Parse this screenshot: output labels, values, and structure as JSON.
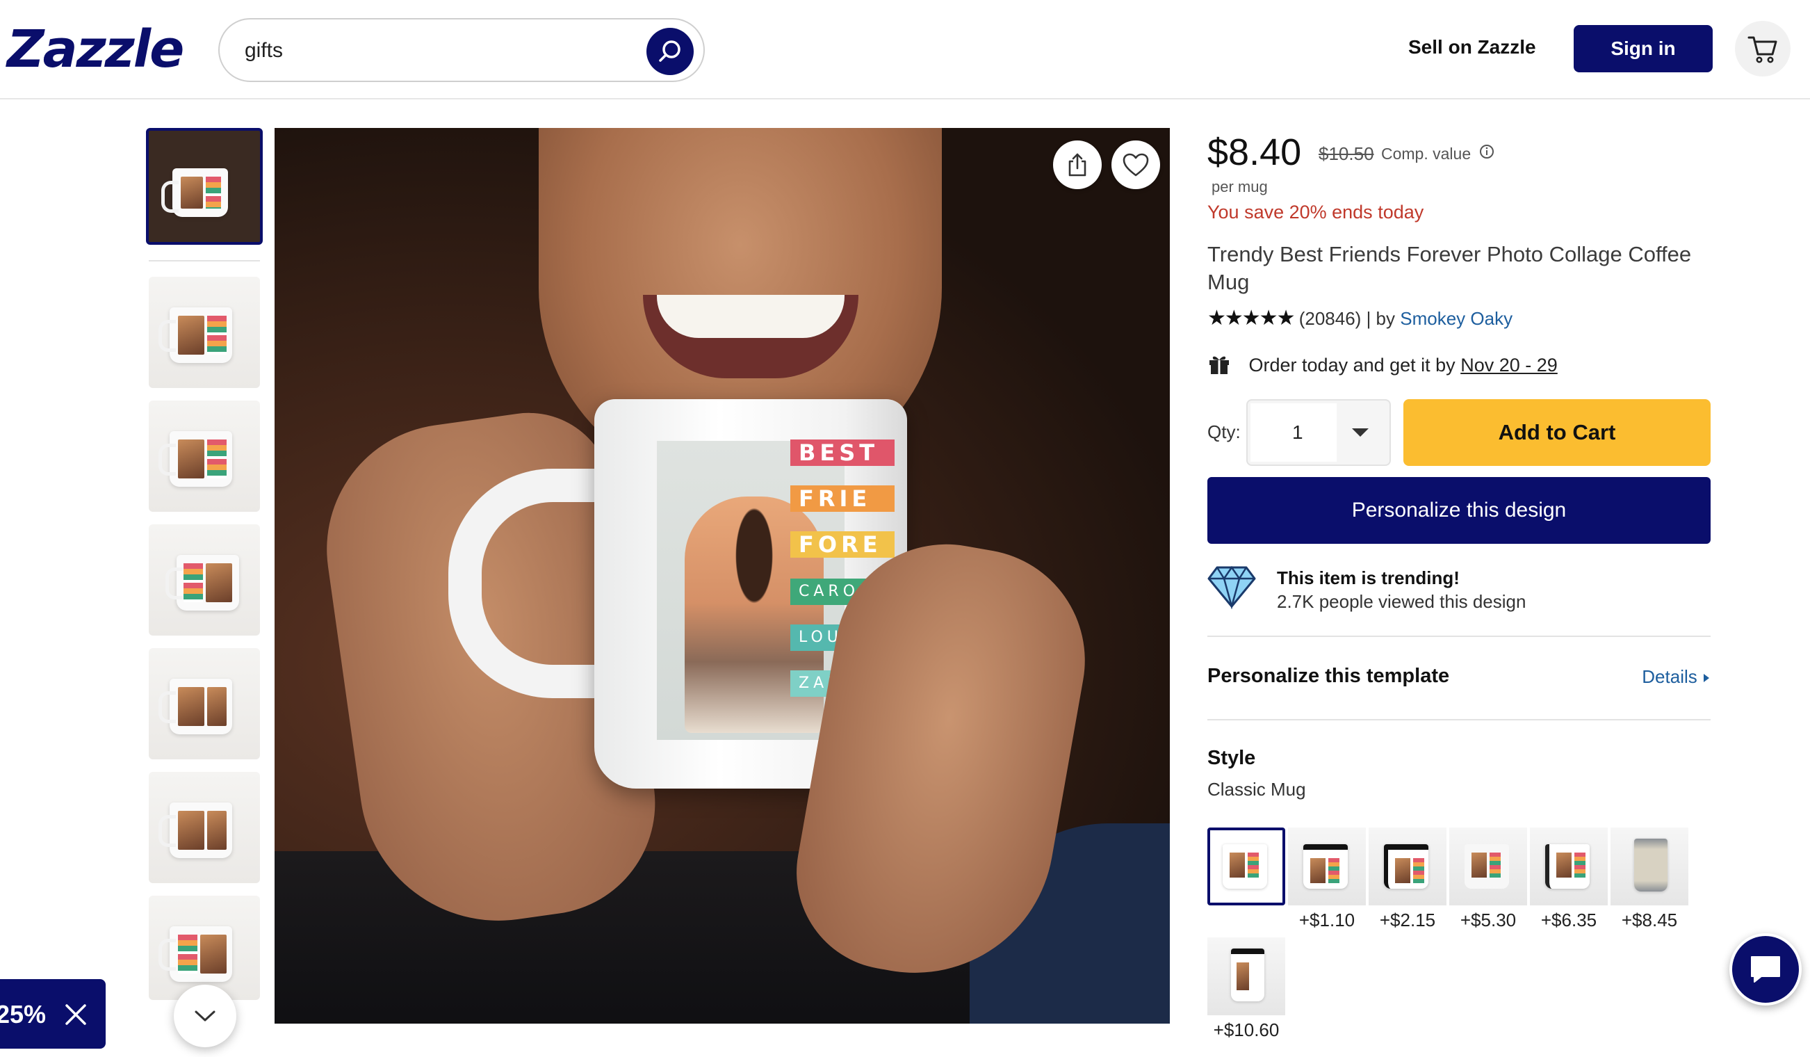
{
  "header": {
    "logo": "Zazzle",
    "search_value": "gifts",
    "sell_label": "Sell on Zazzle",
    "signin_label": "Sign in"
  },
  "gallery": {
    "mug_stripes": [
      "BEST",
      "FRIE",
      "FORE",
      "CAROLIN",
      "LOUISA",
      "ZARA"
    ]
  },
  "promo": {
    "text": "25%"
  },
  "product": {
    "price": "$8.40",
    "comp_price": "$10.50",
    "comp_label": "Comp. value",
    "per_unit": "per mug",
    "savings": "You save 20% ends today",
    "title": "Trendy Best Friends Forever Photo Collage Coffee Mug",
    "stars": "★★★★★",
    "reviews": "(20846)",
    "by_label": "| by",
    "seller": "Smokey Oaky",
    "delivery_text": "Order today and get it by",
    "delivery_date": "Nov 20 - 29",
    "qty_label": "Qty:",
    "qty_value": "1",
    "add_to_cart": "Add to Cart",
    "personalize_button": "Personalize this design",
    "trending_title": "This item is trending!",
    "trending_sub": "2.7K people viewed this design",
    "template_title": "Personalize this template",
    "details_link": "Details",
    "style_label": "Style",
    "style_value": "Classic Mug",
    "style_options": [
      {
        "price": ""
      },
      {
        "price": "+$1.10"
      },
      {
        "price": "+$2.15"
      },
      {
        "price": "+$5.30"
      },
      {
        "price": "+$6.35"
      },
      {
        "price": "+$8.45"
      },
      {
        "price": "+$10.60"
      }
    ]
  },
  "colors": {
    "brand_navy": "#0a0e6b",
    "cart_yellow": "#fbbd30",
    "savings_red": "#c0392b",
    "link_blue": "#1d5e9e"
  }
}
